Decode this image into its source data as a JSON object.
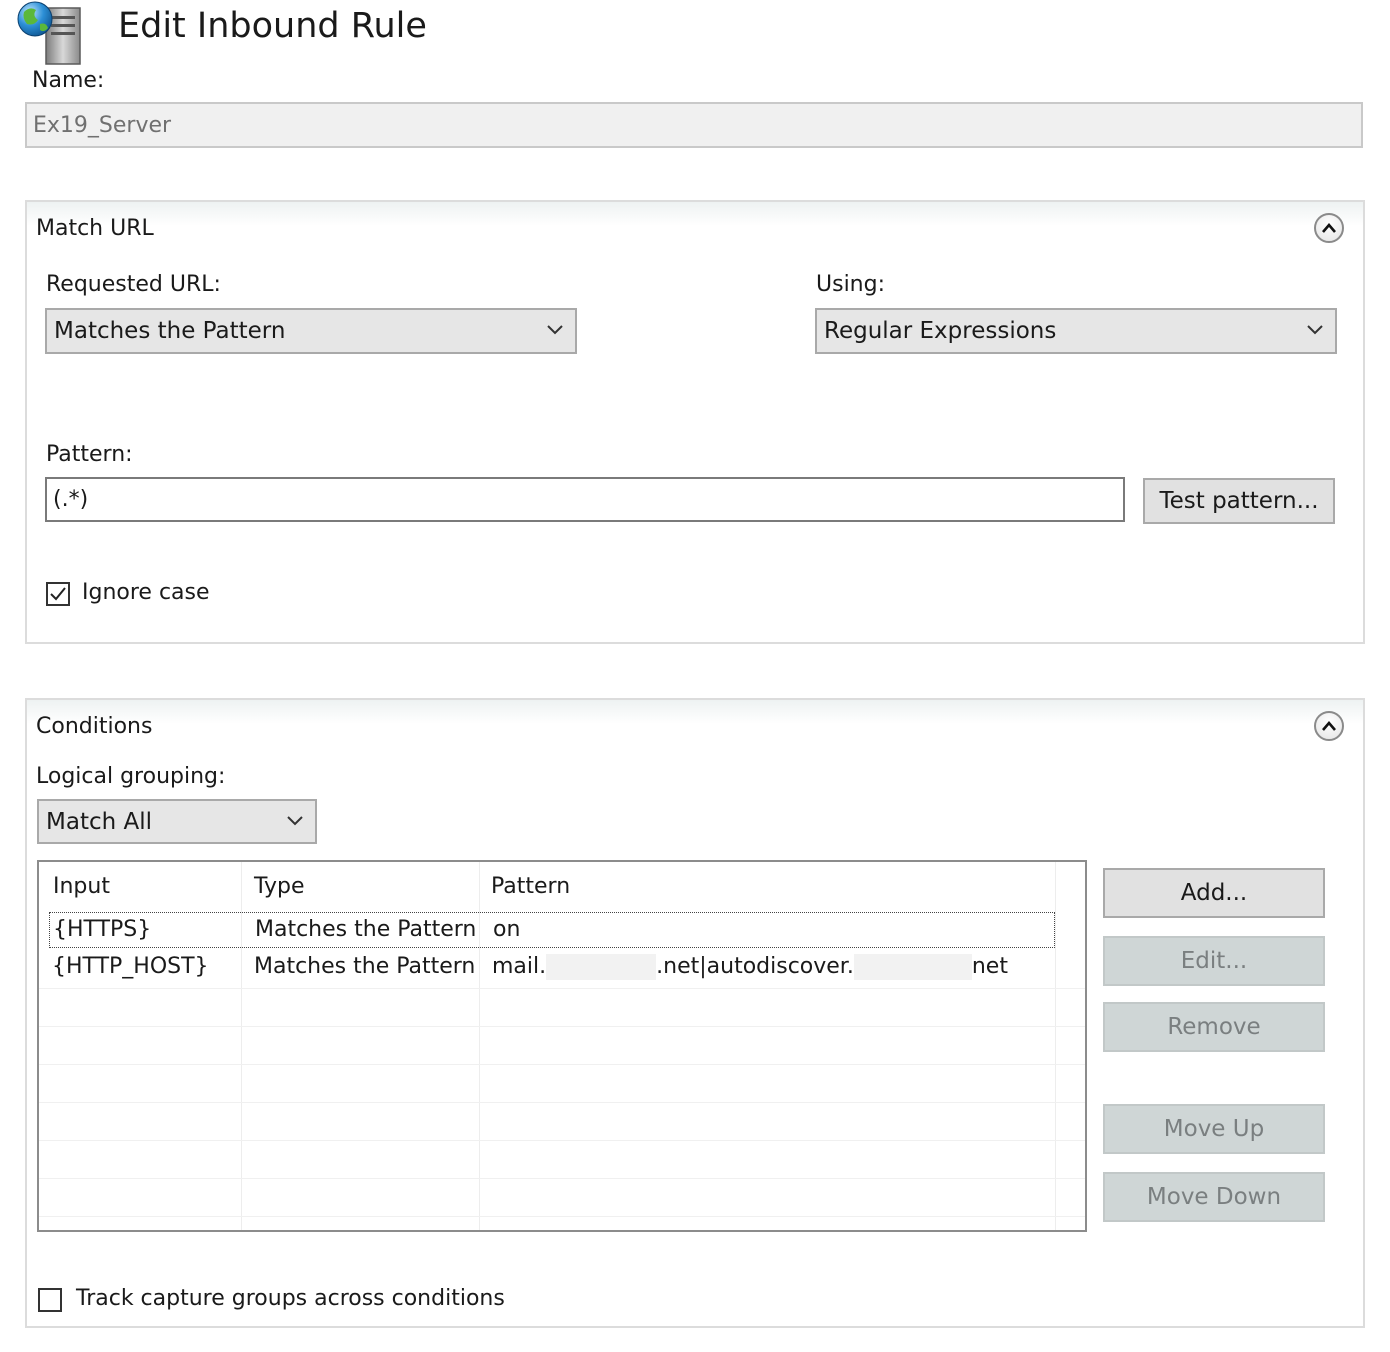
{
  "header": {
    "title": "Edit Inbound Rule",
    "icon": "globe-server-icon"
  },
  "name_field": {
    "label": "Name:",
    "value": "Ex19_Server"
  },
  "match_url": {
    "section_title": "Match URL",
    "requested_url": {
      "label": "Requested URL:",
      "selected": "Matches the Pattern"
    },
    "using": {
      "label": "Using:",
      "selected": "Regular Expressions"
    },
    "pattern": {
      "label": "Pattern:",
      "value": "(.*)"
    },
    "test_pattern_label": "Test pattern...",
    "ignore_case": {
      "label": "Ignore case",
      "checked": true
    }
  },
  "conditions": {
    "section_title": "Conditions",
    "logical_grouping": {
      "label": "Logical grouping:",
      "selected": "Match All"
    },
    "columns": [
      "Input",
      "Type",
      "Pattern"
    ],
    "rows": [
      {
        "input": "{HTTPS}",
        "type": "Matches the Pattern",
        "pattern": "on"
      },
      {
        "input": "{HTTP_HOST}",
        "type": "Matches the Pattern",
        "pattern_parts": [
          "mail.",
          ".net|autodiscover.",
          "net"
        ]
      }
    ],
    "buttons": {
      "add": "Add...",
      "edit": "Edit...",
      "remove": "Remove",
      "move_up": "Move Up",
      "move_down": "Move Down"
    },
    "track_capture": {
      "label": "Track capture groups across conditions",
      "checked": false
    }
  },
  "colors": {
    "panel_border": "#dcdcdc",
    "button_bg": "#e1e1e1",
    "disabled_button_bg": "#cfd6d6",
    "combo_bg": "#e6e6e6"
  }
}
